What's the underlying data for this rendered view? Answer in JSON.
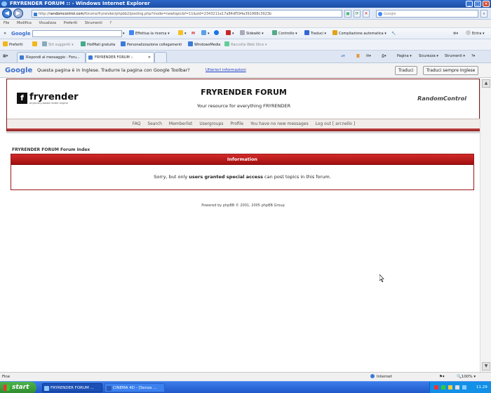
{
  "window": {
    "title": "FRYRENDER FORUM :: - Windows Internet Explorer"
  },
  "address": {
    "prefix": "http://",
    "domain": "randomcontrol.com",
    "path": "/forums/fryrender/phpbb2/posting.php?mode=newtopic&f=11&sid=2343211e17a84df594a391968c3923b"
  },
  "search": {
    "placeholder": "Google"
  },
  "menu": [
    "File",
    "Modifica",
    "Visualizza",
    "Preferiti",
    "Strumenti",
    "?"
  ],
  "google_toolbar": {
    "brand": "Google",
    "search_btn": "Effettua la ricerca",
    "sidewiki": "Sidewiki",
    "check": "Controllo",
    "translate": "Traduci",
    "autofill": "Compilazione automatica",
    "signin": "Entra"
  },
  "favorites": {
    "label": "Preferiti",
    "items": [
      "Siti suggeriti",
      "HotMail gratuita",
      "Personalizzazione collegamenti",
      "WindowsMedia",
      "Raccolta Web Slice"
    ]
  },
  "tabs": [
    {
      "label": "Rispondi al messaggio - Foru..."
    },
    {
      "label": "FRYRENDER FORUM ::"
    }
  ],
  "commands": {
    "page": "Pagina",
    "safety": "Sicurezza",
    "tools": "Strumenti"
  },
  "translate_bar": {
    "logo": "Google",
    "message": "Questa pagina è in Inglese. Tradurre la pagina con Google Toolbar?",
    "more_info": "Ulteriori informazioni",
    "translate_btn": "Traduci",
    "always_btn": "Traduci sempre Inglese"
  },
  "forum": {
    "logo": {
      "glyph": "f",
      "name": "fryrender",
      "tagline": "physically-based render engine"
    },
    "title": "FRYRENDER FORUM",
    "subtitle": "Your resource for everything FRYRENDER",
    "partner_logo": "RandomControl",
    "nav": [
      "FAQ",
      "Search",
      "Memberlist",
      "Usergroups",
      "Profile",
      "You have no new messages",
      "Log out [ arcnello ]"
    ],
    "breadcrumb": "FRYRENDER FORUM Forum Index",
    "info": {
      "heading": "Information",
      "msg_before": "Sorry, but only ",
      "msg_bold": "users granted special access",
      "msg_after": " can post topics in this forum."
    },
    "powered_by": "Powered by phpBB © 2001, 2005 phpBB Group"
  },
  "status": {
    "text": "Fine",
    "zone": "Internet",
    "zoom": "100%"
  },
  "taskbar": {
    "start": "start",
    "tasks": [
      "FRYRENDER FORUM ...",
      "CINEMA 4D - [Senza ..."
    ],
    "clock": "11.29"
  },
  "colors": {
    "accent_red": "#b01414",
    "xp_blue": "#245edb"
  }
}
